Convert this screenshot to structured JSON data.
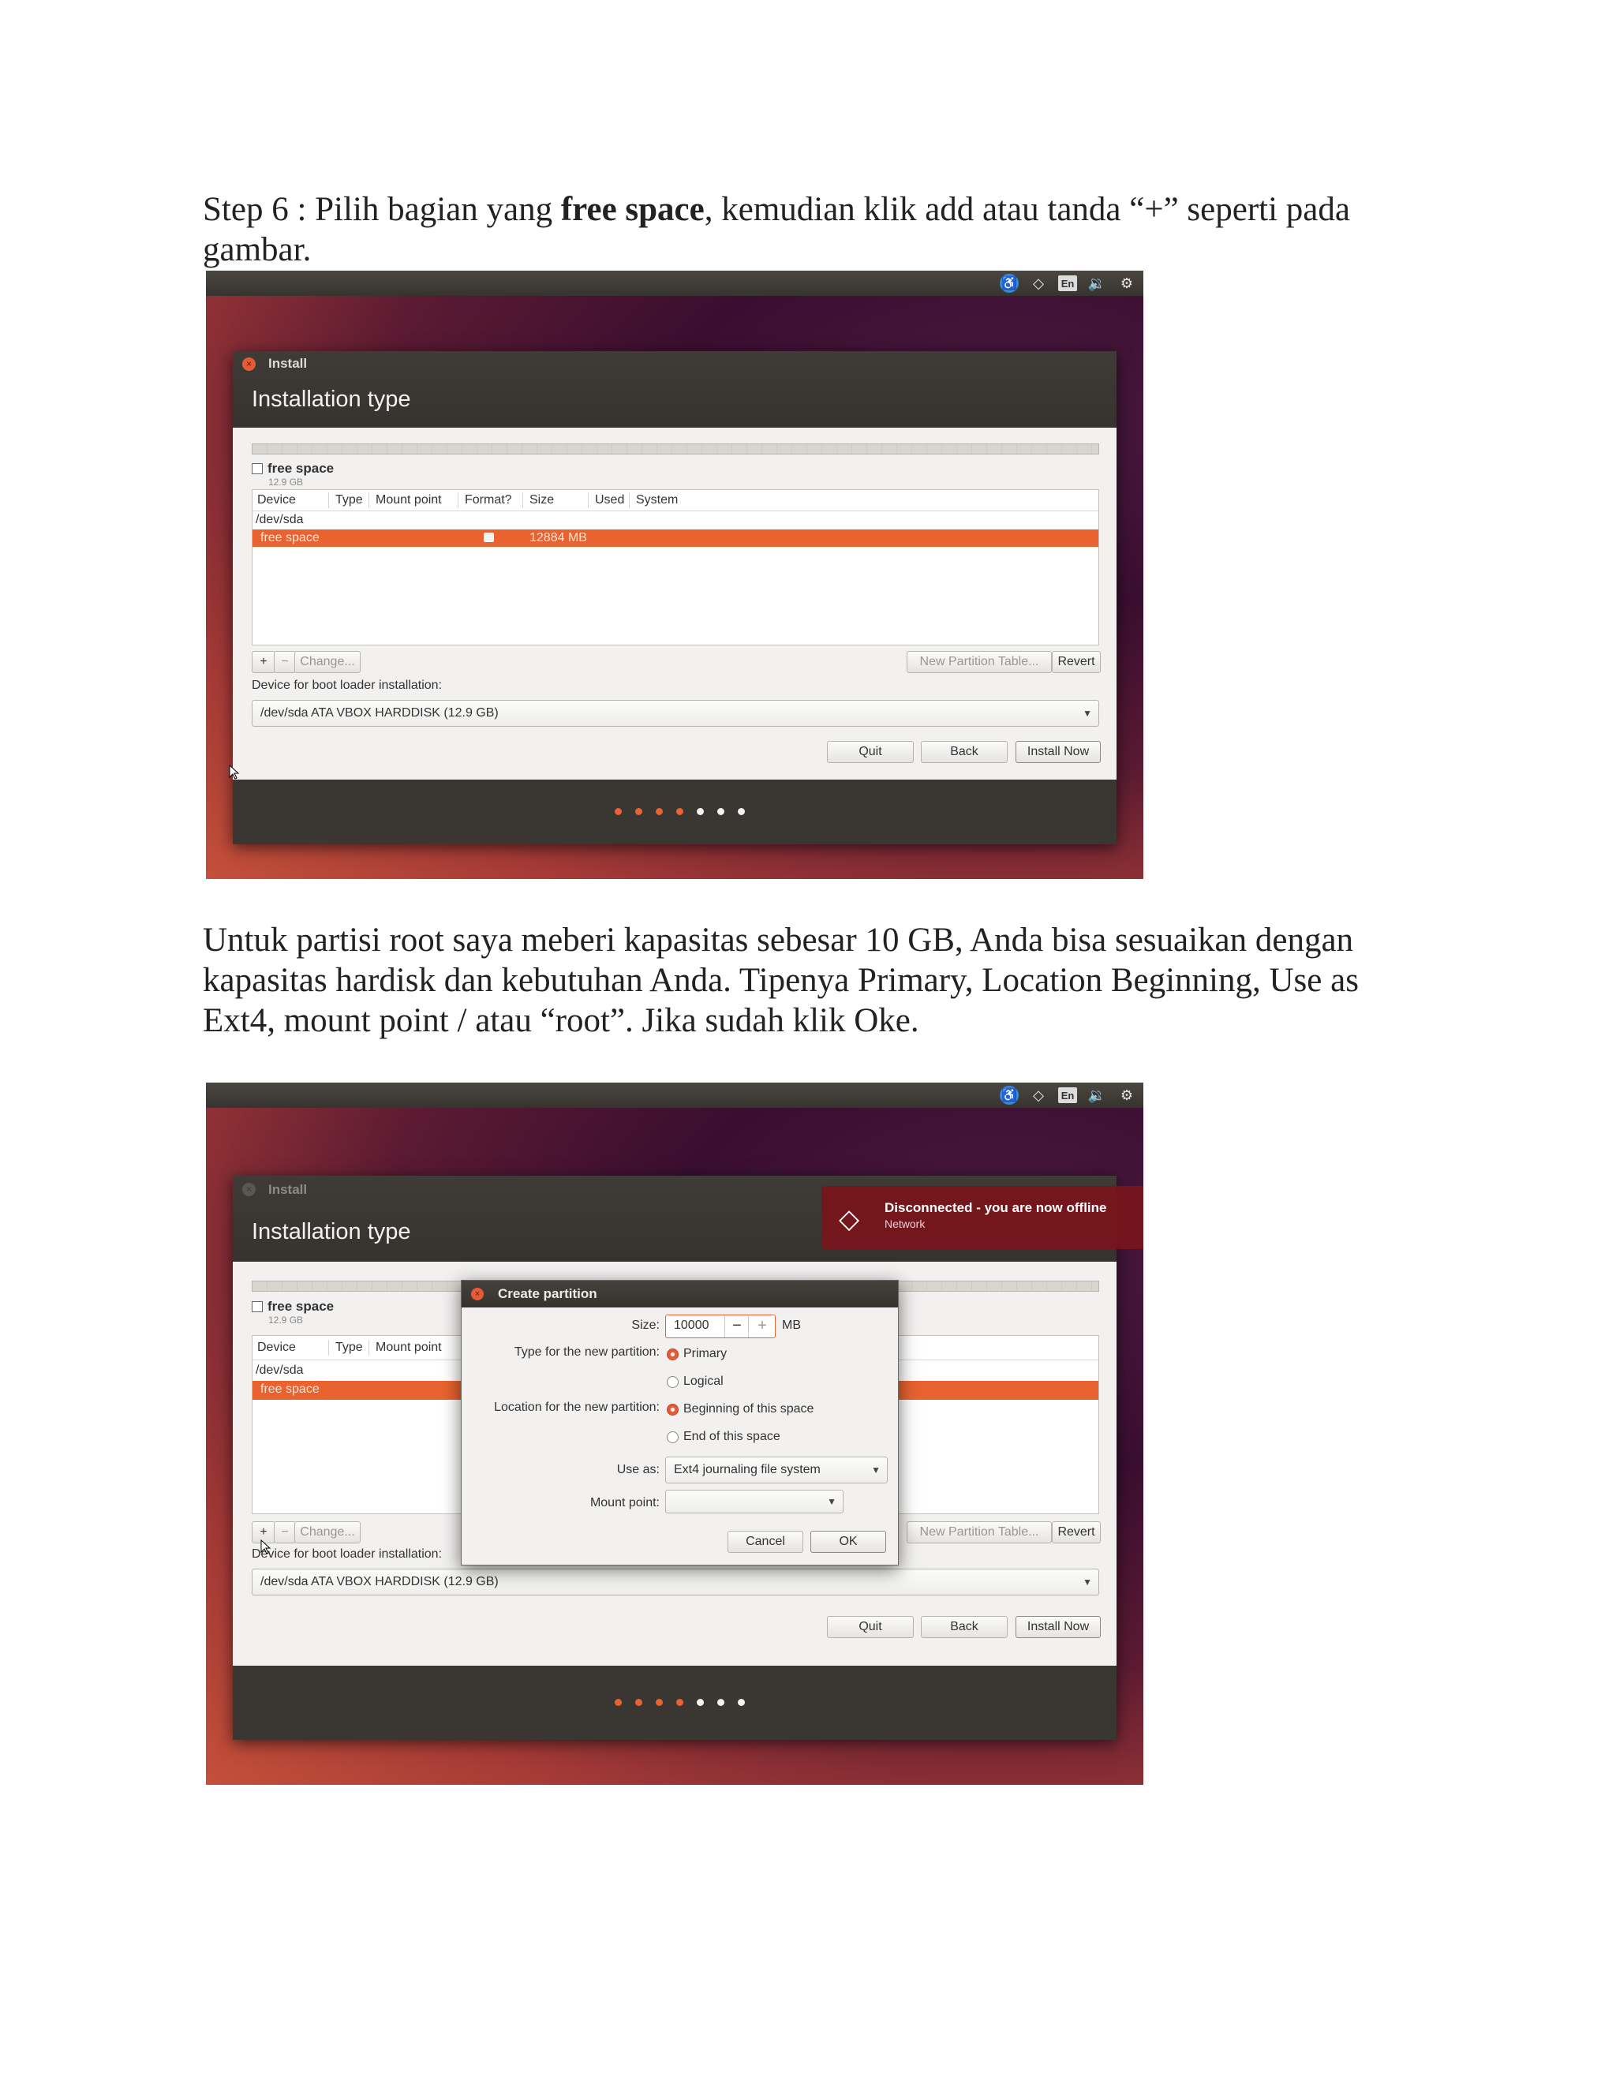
{
  "paragraph1": {
    "prefix": "Step 6 : Pilih bagian yang ",
    "bold": "free space",
    "suffix": ", kemudian klik add atau tanda “+” seperti pada gambar."
  },
  "paragraph2": {
    "text": "Untuk partisi root saya meberi kapasitas sebesar 10 GB, Anda bisa sesuaikan dengan kapasitas hardisk dan kebutuhan Anda. Tipenya Primary, Location Beginning, Use as Ext4, mount point / atau “root”. Jika sudah klik Oke."
  },
  "tray": {
    "language": "En"
  },
  "installer": {
    "window_title": "Install",
    "heading": "Installation type",
    "free_space_label": "free space",
    "free_space_size": "12.9 GB",
    "columns": [
      "Device",
      "Type",
      "Mount point",
      "Format?",
      "Size",
      "Used",
      "System"
    ],
    "rows": [
      {
        "device": "/dev/sda",
        "size": ""
      },
      {
        "device": "free space",
        "size": "12884 MB"
      }
    ],
    "add_label": "+",
    "remove_label": "−",
    "change_label": "Change...",
    "new_table_label": "New Partition Table...",
    "revert_label": "Revert",
    "boot_loader_label": "Device for boot loader installation:",
    "boot_loader_value": "/dev/sda  ATA VBOX HARDDISK (12.9 GB)",
    "quit_label": "Quit",
    "back_label": "Back",
    "install_label": "Install Now",
    "progress": {
      "done": 4,
      "total": 7
    }
  },
  "notification": {
    "title": "Disconnected - you are now offline",
    "subtitle": "Network"
  },
  "create_partition": {
    "title": "Create partition",
    "size_label": "Size:",
    "size_value": "10000",
    "size_unit": "MB",
    "type_label": "Type for the new partition:",
    "type_options": [
      "Primary",
      "Logical"
    ],
    "type_selected": 0,
    "location_label": "Location for the new partition:",
    "location_options": [
      "Beginning of this space",
      "End of this space"
    ],
    "location_selected": 0,
    "use_as_label": "Use as:",
    "use_as_value": "Ext4 journaling file system",
    "mount_label": "Mount point:",
    "mount_value": "",
    "cancel_label": "Cancel",
    "ok_label": "OK"
  },
  "colors": {
    "accent": "#e8632f",
    "notify": "#78141c"
  }
}
